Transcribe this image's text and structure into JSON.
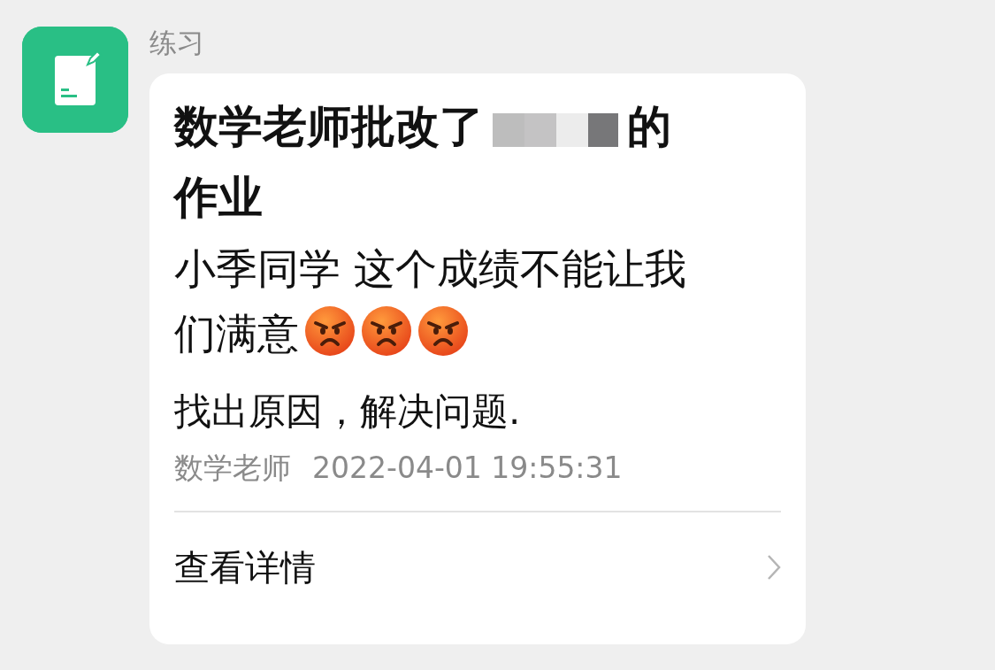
{
  "app": {
    "name": "练习"
  },
  "card": {
    "title_lines": [
      [
        {
          "kind": "text",
          "text": "数学老师批改了"
        },
        {
          "kind": "redaction"
        },
        {
          "kind": "text",
          "text": "的"
        }
      ],
      [
        {
          "kind": "text",
          "text": "作业"
        }
      ]
    ],
    "message_lines": [
      [
        {
          "kind": "text",
          "text": "小季同学 这个成绩不能让我"
        }
      ],
      [
        {
          "kind": "text",
          "text": "们满意"
        },
        {
          "kind": "angry-emoji"
        },
        {
          "kind": "angry-emoji"
        },
        {
          "kind": "angry-emoji"
        }
      ]
    ],
    "note": "找出原因，解决问题.",
    "sender": "数学老师",
    "time": "2022-04-01 19:55:31",
    "action": "查看详情"
  }
}
